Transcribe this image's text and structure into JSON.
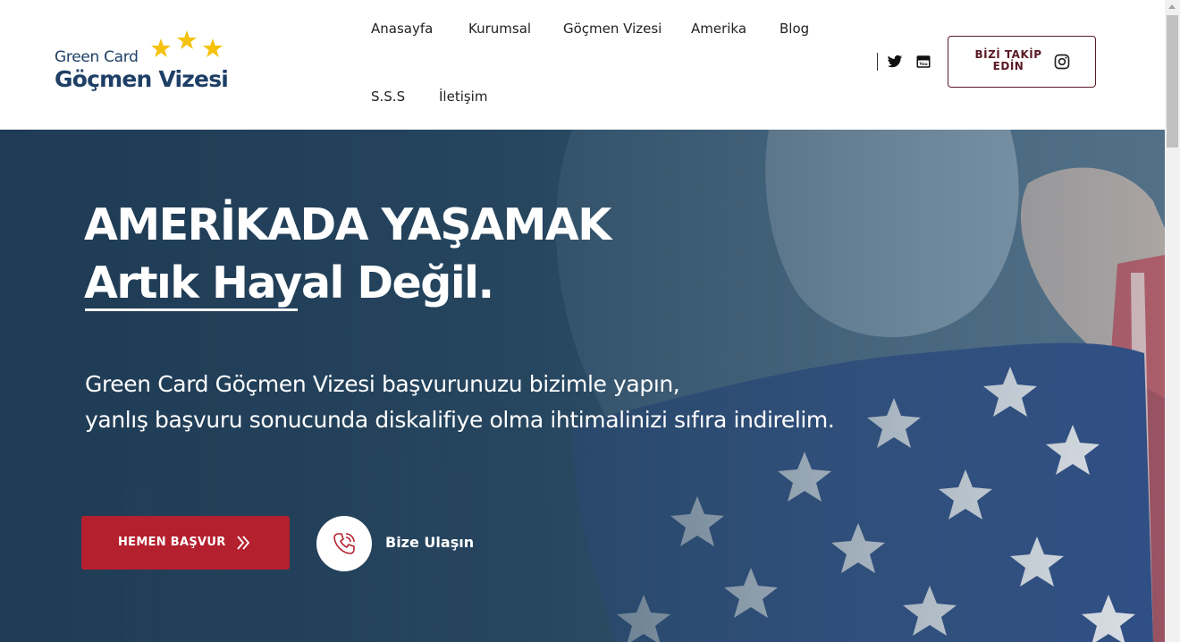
{
  "brand": {
    "logo_line1": "Green Card",
    "logo_line2": "Göçmen Vizesi",
    "primary_color": "#1e3f66",
    "star_color": "#f4c20d"
  },
  "nav": {
    "items": [
      {
        "label": "Anasayfa"
      },
      {
        "label": "Kurumsal"
      },
      {
        "label": "Göçmen Vizesi"
      },
      {
        "label": "Amerika"
      },
      {
        "label": "Blog"
      },
      {
        "label": "S.S.S"
      },
      {
        "label": "İletişim"
      }
    ]
  },
  "social": {
    "icons": [
      "twitter-icon",
      "youtube-icon"
    ],
    "follow_label": "BİZİ TAKİP EDİN",
    "follow_icon": "instagram-icon",
    "follow_color": "#5a1a25"
  },
  "hero": {
    "title_line1": "AMERİKADA YAŞAMAK",
    "title_line2": "Artık Hayal Değil.",
    "subtitle_line1": "Green Card Göçmen Vizesi başvurunuzu bizimle yapın,",
    "subtitle_line2": "yanlış başvuru sonucunda diskalifiye olma ihtimalinizi sıfıra indirelim.",
    "apply_label": "HEMEN BAŞVUR",
    "apply_color": "#b5202e",
    "contact_label": "Bize Ulaşın",
    "contact_icon": "phone-icon"
  }
}
